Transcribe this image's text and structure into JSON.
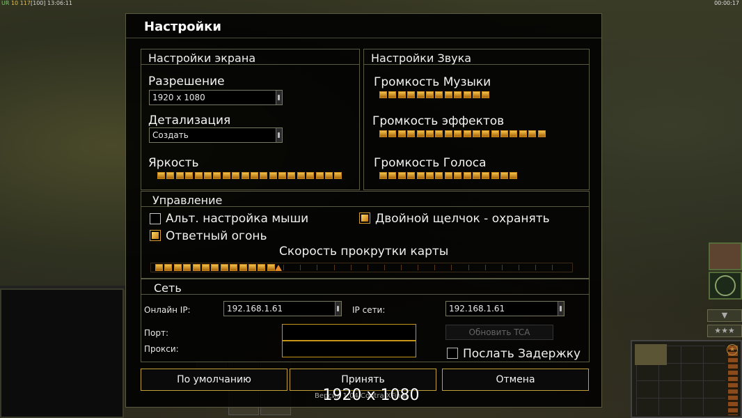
{
  "hud": {
    "top_left_label": "UR",
    "top_left_a": "10",
    "top_left_b": "117",
    "top_left_c": "[100]",
    "top_left_time": "13:06:11",
    "top_right_time": "00:00:17"
  },
  "dialog": {
    "title": "Настройки"
  },
  "screen": {
    "heading": "Настройки экрана",
    "resolution_label": "Разрешение",
    "resolution_value": "1920 x 1080",
    "detail_label": "Детализация",
    "detail_value": "Создать",
    "brightness_label": "Яркость",
    "brightness_level": 1.0,
    "brightness_segments": 20
  },
  "sound": {
    "heading": "Настройки Звука",
    "music_label": "Громкость Музыки",
    "music_level": 1.0,
    "music_segments": 12,
    "effects_label": "Громкость эффектов",
    "effects_level": 1.0,
    "effects_segments": 18,
    "voice_label": "Громкость Голоса",
    "voice_level": 1.0,
    "voice_segments": 15
  },
  "controls": {
    "heading": "Управление",
    "alt_mouse_label": "Альт. настройка мыши",
    "alt_mouse_checked": false,
    "double_click_label": "Двойной щелчок - охранять",
    "double_click_checked": true,
    "return_fire_label": "Ответный огонь",
    "return_fire_checked": true,
    "scroll_speed_label": "Скорость прокрутки карты",
    "scroll_speed_level": 0.28
  },
  "network": {
    "heading": "Сеть",
    "online_ip_label": "Онлайн IP:",
    "online_ip_value": "192.168.1.61",
    "lan_ip_label": "IP сети:",
    "lan_ip_value": "192.168.1.61",
    "port_label": "Порт:",
    "port_value": "",
    "proxy_label": "Прокси:",
    "proxy_value": "",
    "update_tca_label": "Обновить TCA",
    "send_delay_label": "Послать Задержку",
    "send_delay_checked": false
  },
  "buttons": {
    "default_label": "По умолчанию",
    "accept_label": "Принять",
    "cancel_label": "Отмена"
  },
  "overlay": {
    "caption": "1920 x 1080",
    "small_caption": "Версия 1.04 Contra XFinal"
  },
  "colors": {
    "accent_gold": "#c6961a",
    "slider_on": "#f2c14a",
    "panel_border": "#5a5a42"
  }
}
